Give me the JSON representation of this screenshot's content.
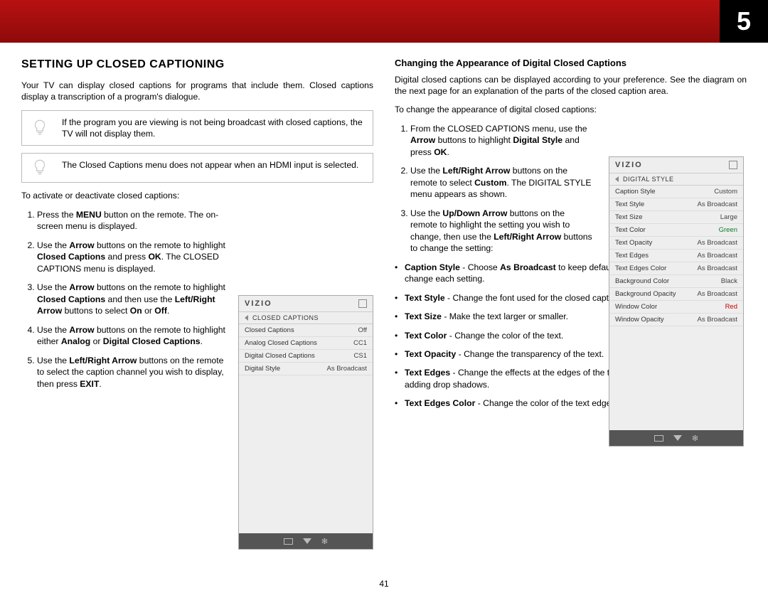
{
  "page": {
    "chapter_number": "5",
    "footer_page": "41"
  },
  "left": {
    "heading": "SETTING UP CLOSED CAPTIONING",
    "intro": "Your TV can display closed captions for programs that include them. Closed captions display a transcription of a program's dialogue.",
    "note1": "If the program you are viewing is not being broadcast with closed captions, the TV will not display them.",
    "note2": "The Closed Captions menu does not appear when an HDMI input is selected.",
    "lead": "To activate or deactivate closed captions:",
    "steps": [
      {
        "pre": "Press the ",
        "b1": "MENU",
        "post": " button on the remote. The on-screen menu is displayed."
      },
      {
        "text_html": "Use the <b>Arrow</b> buttons on the remote to highlight <b>Closed Captions</b> and press <b>OK</b>. The CLOSED CAPTIONS menu is displayed."
      },
      {
        "text_html": "Use the <b>Arrow</b> buttons on the remote to highlight <b>Closed Captions</b> and then use the <b>Left/Right Arrow</b> buttons to select <b>On</b> or <b>Off</b>."
      },
      {
        "text_html": "Use the <b>Arrow</b> buttons on the remote to highlight either <b>Analog</b> or <b>Digital Closed Captions</b>."
      },
      {
        "text_html": "Use the <b>Left/Right Arrow</b> buttons on the remote to select the caption channel you wish to display, then press <b>EXIT</b>."
      }
    ]
  },
  "right": {
    "subheading": "Changing the Appearance of Digital Closed Captions",
    "intro": "Digital closed captions can be displayed according to your preference. See the diagram on the next page for an explanation of the parts of the closed caption area.",
    "lead": "To change the appearance of digital closed captions:",
    "steps": [
      {
        "text_html": "From the CLOSED CAPTIONS menu, use the <b>Arrow</b> buttons to highlight <b>Digital Style</b> and press <b>OK</b>."
      },
      {
        "text_html": "Use the <b>Left/Right Arrow</b> buttons on the remote to select <b>Custom</b>. The DIGITAL STYLE menu appears as shown."
      },
      {
        "text_html": "Use the <b>Up/Down Arrow</b> buttons on the remote to highlight the setting you wish to change, then use the <b>Left/Right Arrow</b> buttons to change the setting:"
      }
    ],
    "bullets": [
      {
        "b": "Caption Style",
        "rest": " - Choose <b>As Broadcast</b> to keep default settings or <b>Custom</b> to manually change each setting."
      },
      {
        "b": "Text Style",
        "rest": "  - Change the font used for the closed captioning text."
      },
      {
        "b": "Text Size",
        "rest": " - Make the text larger or smaller."
      },
      {
        "b": "Text Color",
        "rest": " - Change the color of the text."
      },
      {
        "b": "Text Opacity",
        "rest": " - Change the transparency of the text."
      },
      {
        "b": "Text Edges",
        "rest": " - Change the effects at the edges of the text, such as raising the edges or adding drop shadows."
      },
      {
        "b": "Text Edges Color",
        "rest": " - Change the color of the text edge effects."
      }
    ]
  },
  "osd1": {
    "brand": "VIZIO",
    "crumb": "CLOSED CAPTIONS",
    "rows": [
      {
        "k": "Closed Captions",
        "v": "Off"
      },
      {
        "k": "Analog Closed Captions",
        "v": "CC1"
      },
      {
        "k": "Digital Closed Captions",
        "v": "CS1"
      },
      {
        "k": "Digital Style",
        "v": "As Broadcast"
      }
    ]
  },
  "osd2": {
    "brand": "VIZIO",
    "crumb": "DIGITAL STYLE",
    "rows": [
      {
        "k": "Caption Style",
        "v": "Custom",
        "cls": ""
      },
      {
        "k": "Text Style",
        "v": "As Broadcast",
        "cls": ""
      },
      {
        "k": "Text Size",
        "v": "Large",
        "cls": ""
      },
      {
        "k": "Text Color",
        "v": "Green",
        "cls": "green"
      },
      {
        "k": "Text Opacity",
        "v": "As Broadcast",
        "cls": ""
      },
      {
        "k": "Text Edges",
        "v": "As Broadcast",
        "cls": ""
      },
      {
        "k": "Text Edges Color",
        "v": "As Broadcast",
        "cls": ""
      },
      {
        "k": "Background Color",
        "v": "Black",
        "cls": ""
      },
      {
        "k": "Background Opacity",
        "v": "As Broadcast",
        "cls": ""
      },
      {
        "k": "Window Color",
        "v": "Red",
        "cls": "red"
      },
      {
        "k": "Window Opacity",
        "v": "As Broadcast",
        "cls": ""
      }
    ]
  }
}
